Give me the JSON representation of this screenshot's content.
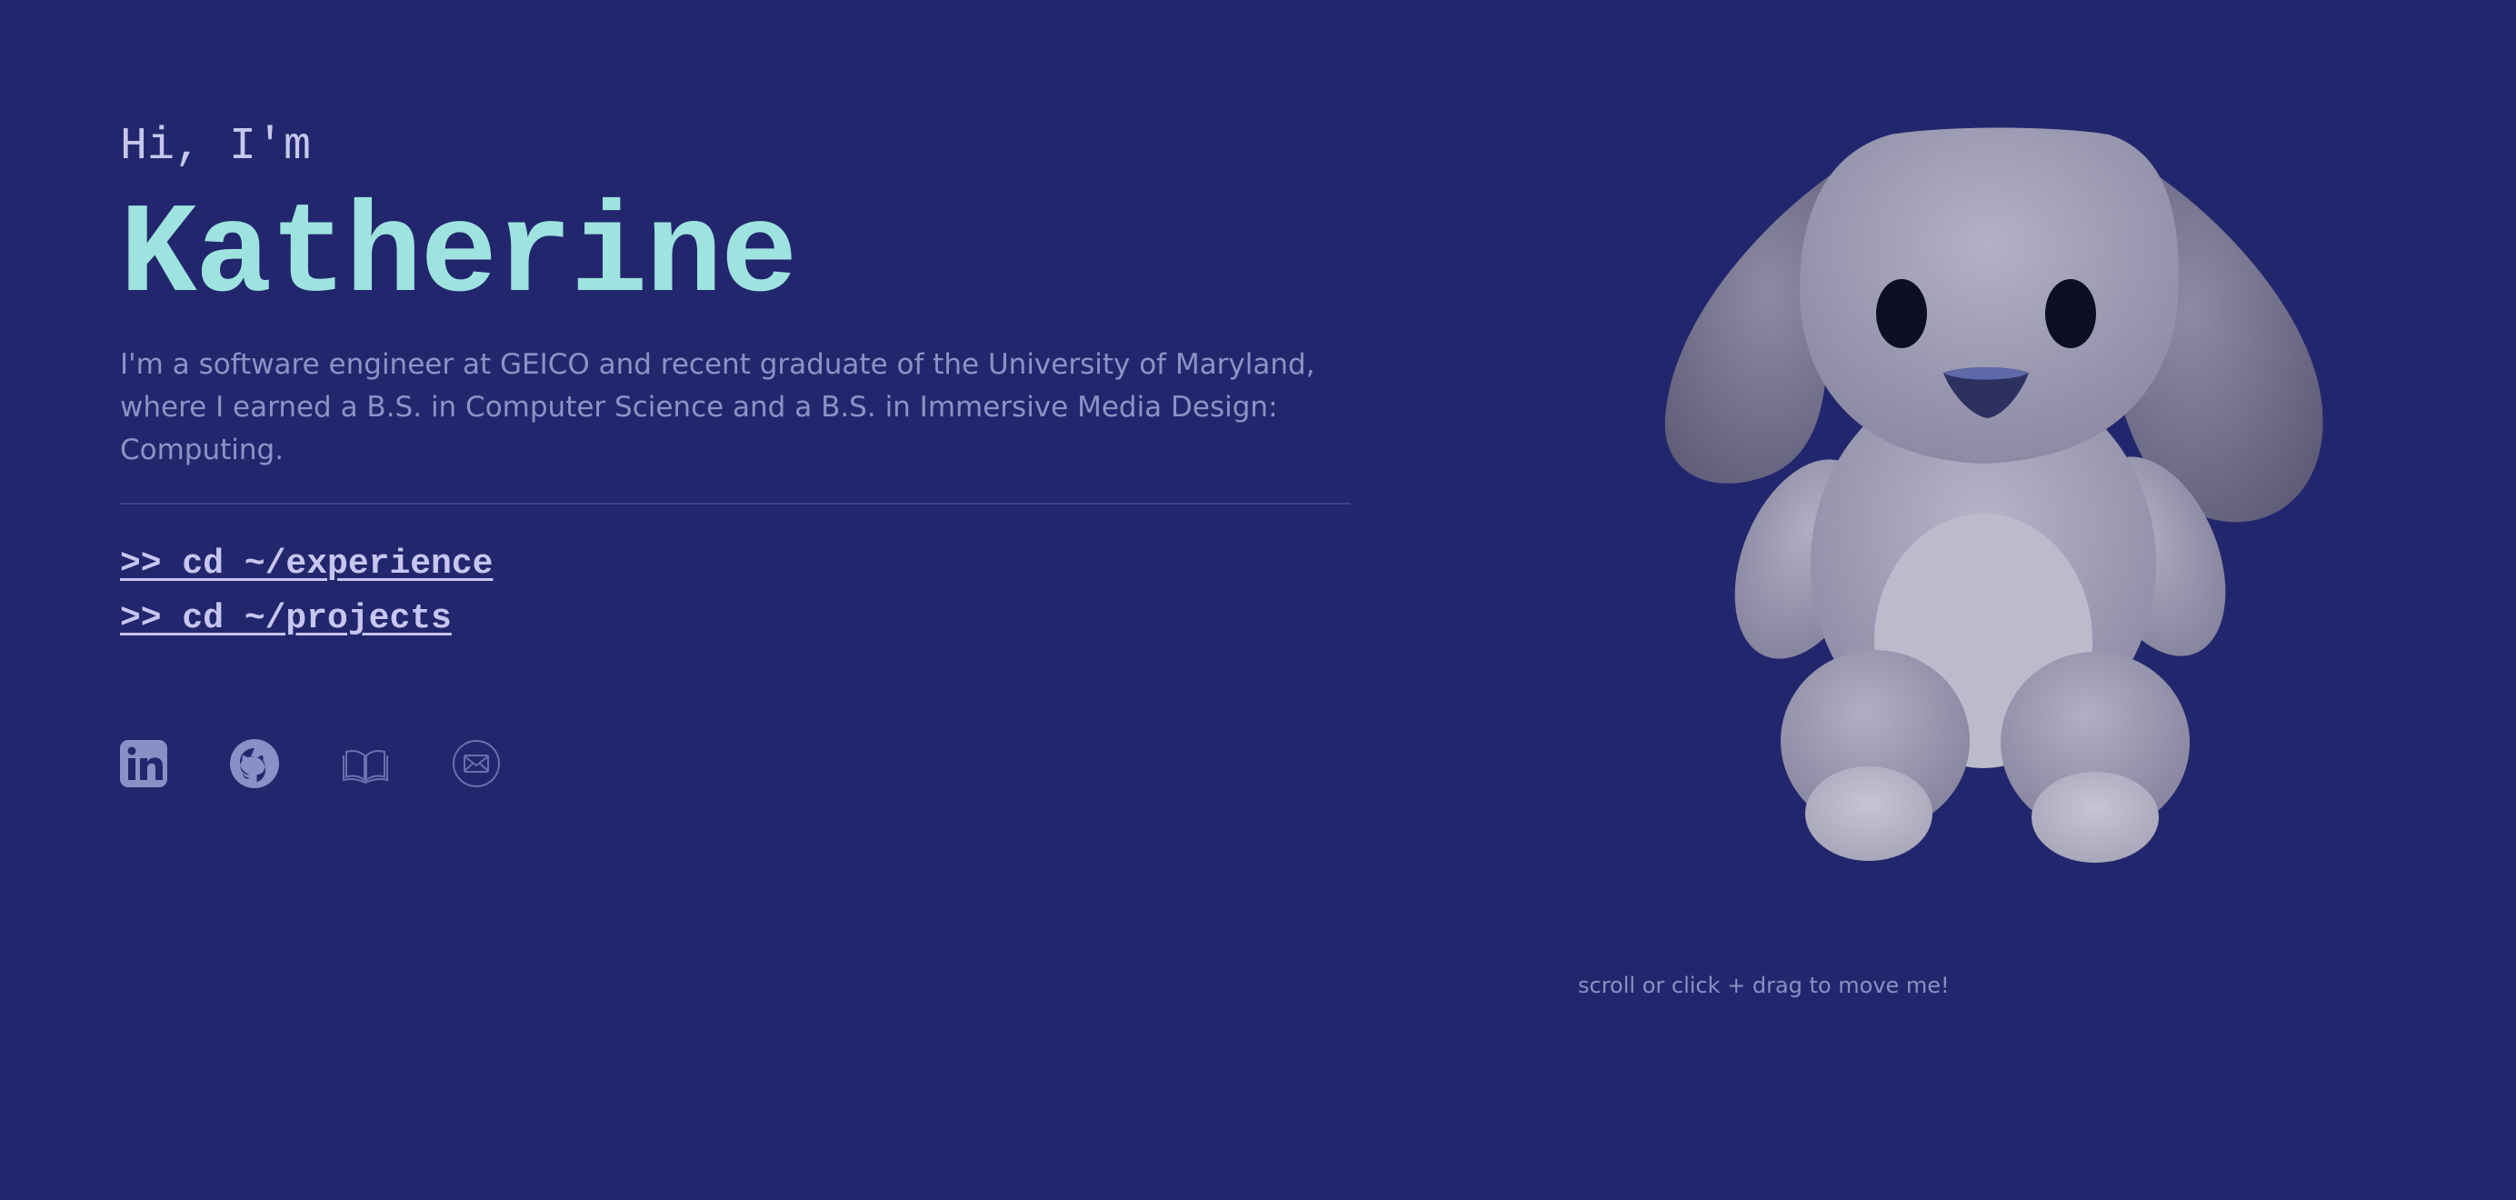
{
  "hero": {
    "greeting": "Hi, I'm",
    "name": "Katherine",
    "bio": "I'm a software engineer at GEICO and recent graduate of the University of Maryland, where I earned a B.S. in Computer Science and a B.S. in Immersive Media Design: Computing."
  },
  "nav": {
    "experience": ">> cd ~/experience",
    "projects": ">> cd ~/projects"
  },
  "socials": [
    {
      "icon": "linkedin-icon"
    },
    {
      "icon": "github-icon"
    },
    {
      "icon": "book-icon"
    },
    {
      "icon": "mail-icon"
    }
  ],
  "viewer": {
    "hint": "scroll or click + drag to move me!"
  },
  "colors": {
    "background": "#22276d",
    "accent": "#9ee3df",
    "text": "#8d92c6",
    "link": "#c7c6f2"
  }
}
